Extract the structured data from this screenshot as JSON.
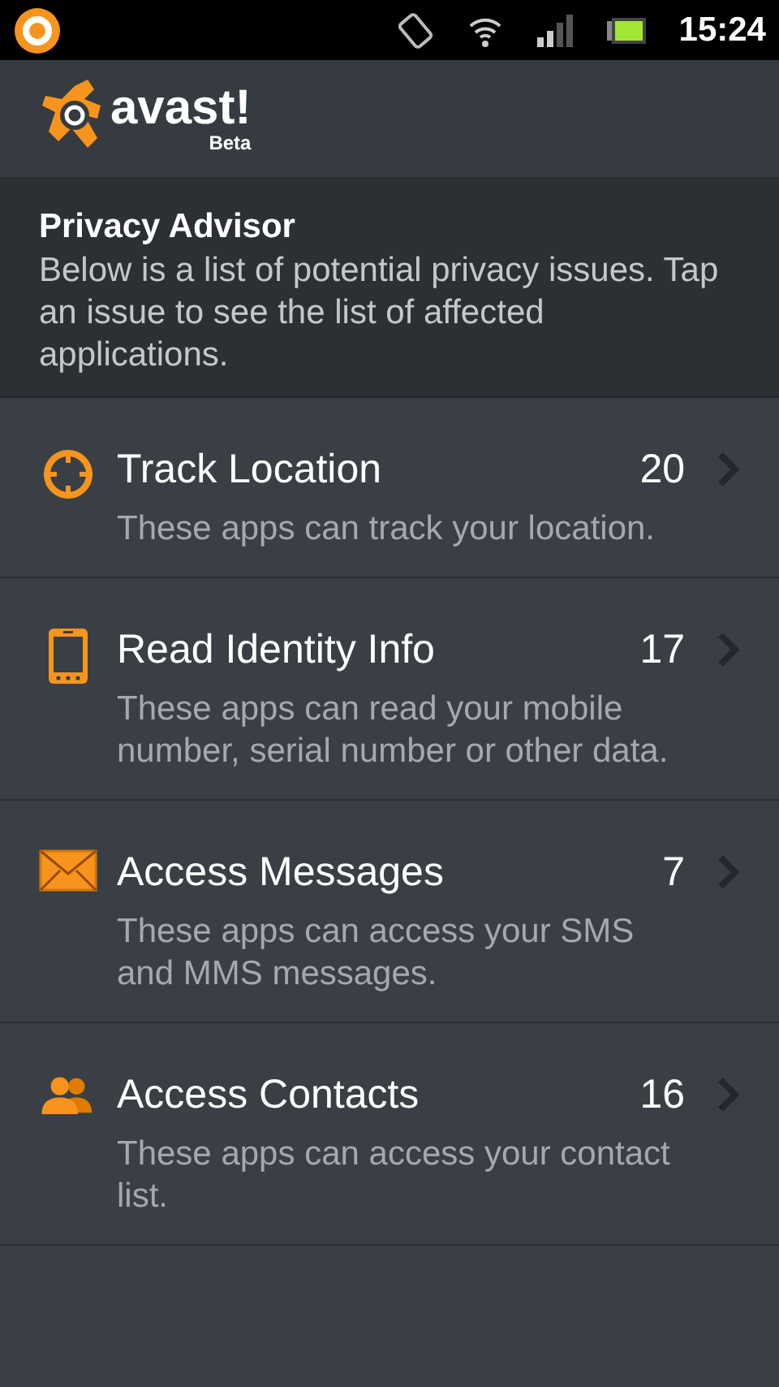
{
  "status_bar": {
    "time": "15:24"
  },
  "header": {
    "logo_text": "avast!",
    "badge": "Beta"
  },
  "intro": {
    "title": "Privacy Advisor",
    "text": "Below is a list of potential privacy issues. Tap an issue to see the list of affected applications."
  },
  "issues": [
    {
      "kind": "location",
      "title": "Track Location",
      "count": "20",
      "description": "These apps can track your location."
    },
    {
      "kind": "identity",
      "title": "Read Identity Info",
      "count": "17",
      "description": "These apps can read your mobile number, serial number or other data."
    },
    {
      "kind": "messages",
      "title": "Access Messages",
      "count": "7",
      "description": "These apps can access your SMS and MMS messages."
    },
    {
      "kind": "contacts",
      "title": "Access Contacts",
      "count": "16",
      "description": "These apps can access your contact list."
    }
  ]
}
